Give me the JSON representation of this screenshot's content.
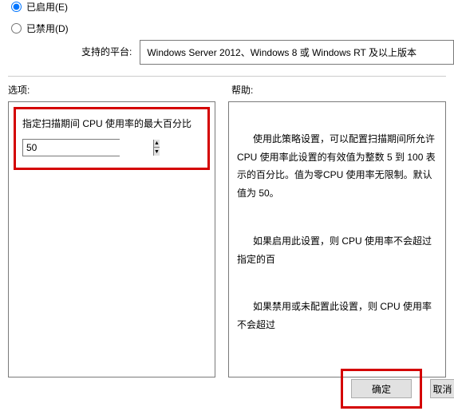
{
  "radios": {
    "enabled_label": "已启用(E)",
    "disabled_label": "已禁用(D)"
  },
  "platform": {
    "label": "支持的平台:",
    "value": "Windows Server 2012、Windows 8 或 Windows RT 及以上版本"
  },
  "sections": {
    "options_label": "选项:",
    "help_label": "帮助:"
  },
  "option": {
    "label": "指定扫描期间 CPU 使用率的最大百分比",
    "value": "50"
  },
  "help": {
    "p1": "使用此策略设置，可以配置扫描期间所允许 CPU 使用率此设置的有效值为整数 5 到 100 表示的百分比。值为零CPU 使用率无限制。默认值为 50。",
    "p2": "如果启用此设置，则 CPU 使用率不会超过指定的百",
    "p3": "如果禁用或未配置此设置，则 CPU 使用率不会超过"
  },
  "buttons": {
    "ok": "确定",
    "cancel": "取消"
  }
}
